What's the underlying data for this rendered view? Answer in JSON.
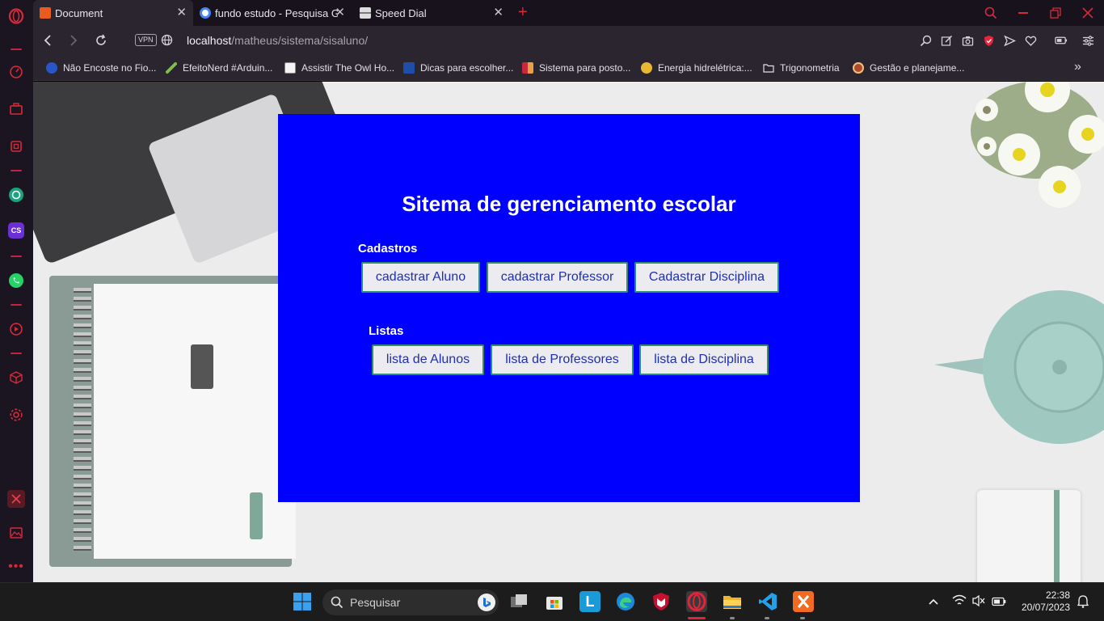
{
  "browser": {
    "tabs": [
      {
        "label": "Document",
        "active": true
      },
      {
        "label": "fundo estudo - Pesquisa Go",
        "active": false
      },
      {
        "label": "Speed Dial",
        "active": false
      }
    ],
    "vpn_badge": "VPN",
    "url_host": "localhost",
    "url_path": "/matheus/sistema/sisaluno/",
    "bookmarks": [
      "Não Encoste no Fio...",
      "EfeitoNerd #Arduin...",
      "Assistir The Owl Ho...",
      "Dicas para escolher...",
      "Sistema para posto...",
      "Energia hidrelétrica:...",
      "Trigonometria",
      "Gestão e planejame..."
    ],
    "sidebar_cs_label": "CS"
  },
  "page": {
    "title": "Sitema de gerenciamento escolar",
    "cadastros_label": "Cadastros",
    "cadastros_buttons": [
      "cadastrar Aluno",
      "cadastrar Professor",
      "Cadastrar Disciplina"
    ],
    "listas_label": "Listas",
    "listas_buttons": [
      "lista de Alunos",
      "lista de Professores",
      "lista de Disciplina"
    ],
    "panel_color": "#0000ff"
  },
  "taskbar": {
    "search_placeholder": "Pesquisar",
    "time": "22:38",
    "date": "20/07/2023"
  }
}
